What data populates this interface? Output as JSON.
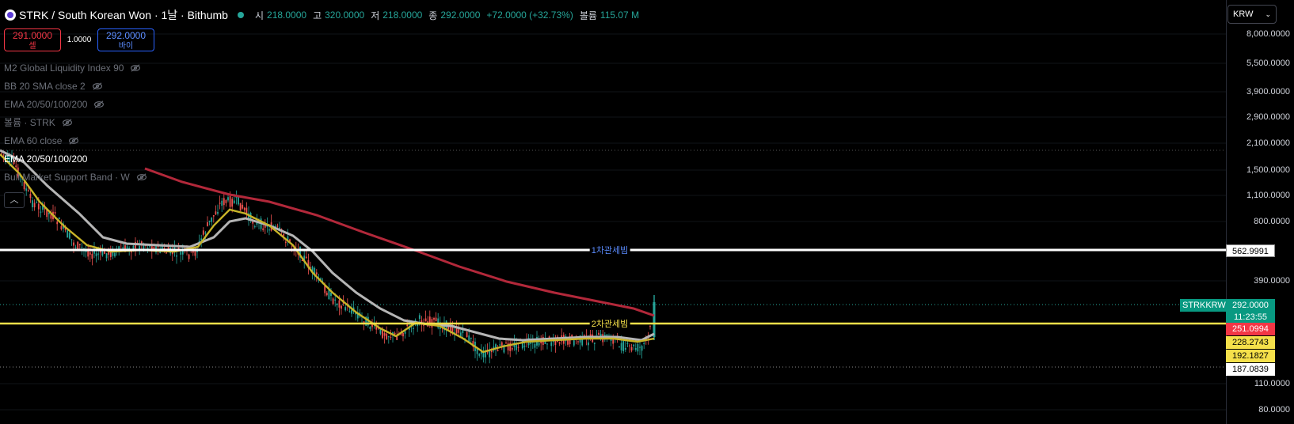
{
  "header": {
    "symbol_title": "STRK / South Korean Won · 1날 · Bithumb",
    "open_label": "시",
    "open_value": "218.0000",
    "high_label": "고",
    "high_value": "320.0000",
    "low_label": "저",
    "low_value": "218.0000",
    "close_label": "종",
    "close_value": "292.0000",
    "change": "+72.0000 (+32.73%)",
    "volume_label": "볼륨",
    "volume_value": "115.07 M"
  },
  "order": {
    "sell_price": "291.0000",
    "sell_label": "셀",
    "spread": "1.0000",
    "buy_price": "292.0000",
    "buy_label": "바이"
  },
  "legend": {
    "items": [
      {
        "label": "M2 Global Liquidity Index 90",
        "hidden": true
      },
      {
        "label": "BB 20 SMA close 2",
        "hidden": true
      },
      {
        "label": "EMA 20/50/100/200",
        "hidden": true
      },
      {
        "label": "볼륨 · STRK",
        "hidden": true
      },
      {
        "label": "EMA 60 close",
        "hidden": true
      },
      {
        "label": "EMA 20/50/100/200",
        "hidden": false
      },
      {
        "label": "Bull Market Support Band · W",
        "hidden": true
      }
    ],
    "collapse_icon": "chevron-up-icon"
  },
  "currency": "KRW",
  "price_scale": {
    "ticks": [
      "8,000.0000",
      "5,500.0000",
      "3,900.0000",
      "2,900.0000",
      "2,100.0000",
      "1,500.0000",
      "1,100.0000",
      "800.0000",
      "390.0000",
      "110.0000",
      "80.0000"
    ]
  },
  "price_labels": {
    "line1_value": "562.9991",
    "current_price": "292.0000",
    "countdown": "11:23:55",
    "red_value": "251.0994",
    "yellow1_value": "228.2743",
    "yellow2_value": "192.1827",
    "white_value": "187.0839",
    "symbol_tag": "STRKKRW"
  },
  "annotations": {
    "line1_text": "1차관세빔",
    "line2_text": "2차관세빔"
  },
  "colors": {
    "up": "#26a69a",
    "down": "#ef5350",
    "ema200": "#b2283a",
    "ema_gray": "#b5b5b5",
    "ema_yellow": "#c8b428",
    "line1": "#ffffff",
    "line2": "#f5e04a"
  },
  "chart_data": {
    "type": "candlestick",
    "scale": "log",
    "series": [
      {
        "name": "EMA 20/50/100/200"
      }
    ],
    "horizontal_lines": [
      {
        "label": "1차관세빔",
        "value": 562.9991
      },
      {
        "label": "2차관세빔",
        "value": 251.0994
      }
    ],
    "last": {
      "open": 218.0,
      "high": 320.0,
      "low": 218.0,
      "close": 292.0
    }
  }
}
